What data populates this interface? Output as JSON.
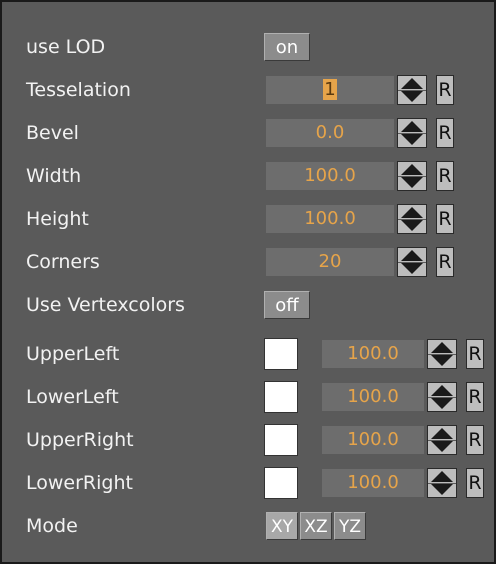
{
  "rows": {
    "use_lod": {
      "label": "use LOD",
      "toggle": "on"
    },
    "tesselation": {
      "label": "Tesselation",
      "value": "1",
      "reset": "R"
    },
    "bevel": {
      "label": "Bevel",
      "value": "0.0",
      "reset": "R"
    },
    "width": {
      "label": "Width",
      "value": "100.0",
      "reset": "R"
    },
    "height": {
      "label": "Height",
      "value": "100.0",
      "reset": "R"
    },
    "corners": {
      "label": "Corners",
      "value": "20",
      "reset": "R"
    },
    "use_vertexcolors": {
      "label": "Use Vertexcolors",
      "toggle": "off"
    },
    "upper_left": {
      "label": "UpperLeft",
      "value": "100.0",
      "reset": "R",
      "color": "#ffffff"
    },
    "lower_left": {
      "label": "LowerLeft",
      "value": "100.0",
      "reset": "R",
      "color": "#ffffff"
    },
    "upper_right": {
      "label": "UpperRight",
      "value": "100.0",
      "reset": "R",
      "color": "#ffffff"
    },
    "lower_right": {
      "label": "LowerRight",
      "value": "100.0",
      "reset": "R",
      "color": "#ffffff"
    },
    "mode": {
      "label": "Mode",
      "options": [
        "XY",
        "XZ",
        "YZ"
      ],
      "selected": "XY"
    }
  },
  "colors": {
    "panel_bg": "#5a5a5a",
    "value_text": "#e6a44a",
    "label_text": "#f2f2f2"
  }
}
